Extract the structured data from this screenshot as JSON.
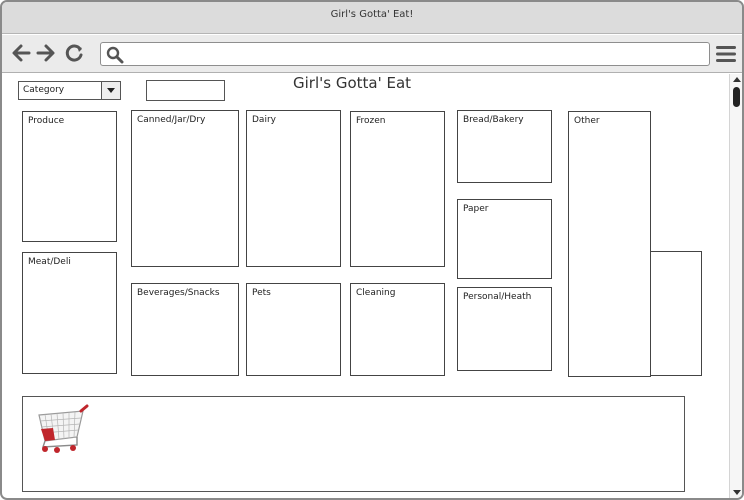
{
  "window": {
    "title": "Girl's Gotta' Eat!"
  },
  "toolbar": {
    "url_value": ""
  },
  "page": {
    "title": "Girl's Gotta' Eat",
    "category_select": {
      "selected": "Category"
    },
    "search_box": {
      "value": ""
    }
  },
  "bins": {
    "produce": "Produce",
    "canned": "Canned/Jar/Dry",
    "dairy": "Dairy",
    "frozen": "Frozen",
    "bread": "Bread/Bakery",
    "other": "Other",
    "paper": "Paper",
    "meat": "Meat/Deli",
    "beverages": "Beverages/Snacks",
    "pets": "Pets",
    "cleaning": "Cleaning",
    "personal": "Personal/Heath"
  },
  "icons": {
    "back": "arrow-left-icon",
    "forward": "arrow-right-icon",
    "reload": "reload-icon",
    "search": "search-icon",
    "menu": "hamburger-menu-icon",
    "cart": "shopping-cart-icon"
  },
  "colors": {
    "titlebar_bg": "#dcdcdc",
    "toolbar_bg": "#ebebeb",
    "border": "#444444",
    "cart_red": "#c0262c"
  }
}
